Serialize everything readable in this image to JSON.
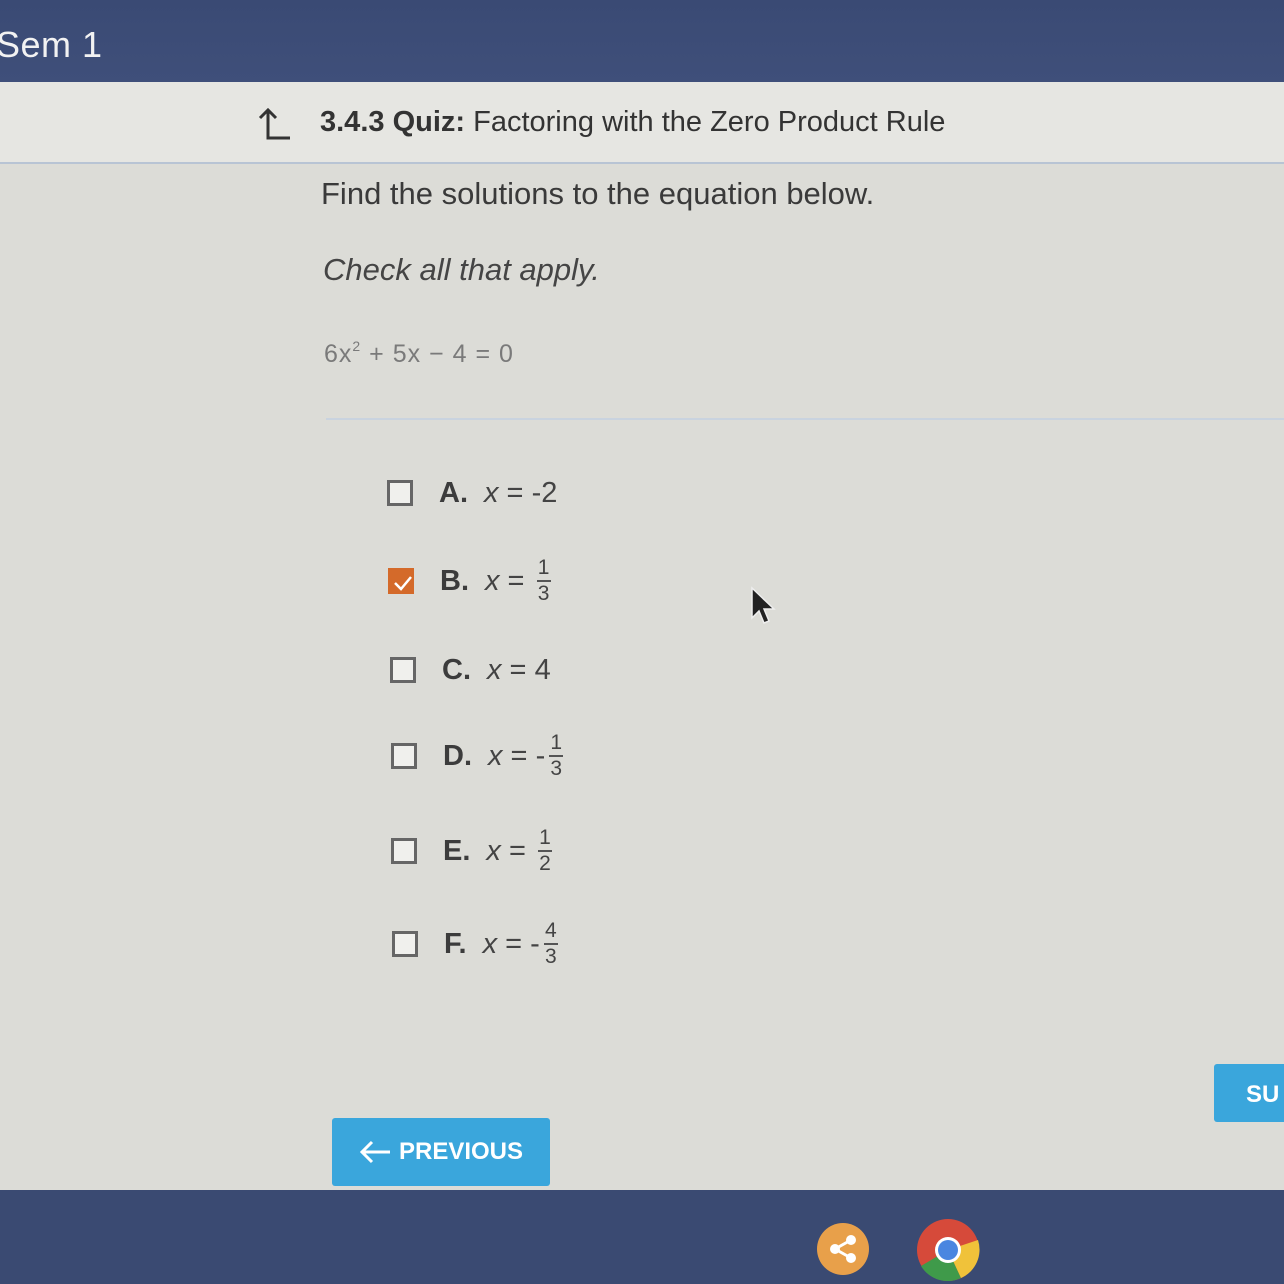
{
  "header": {
    "course": "Sem 1"
  },
  "quiz_title": {
    "number": "3.4.3",
    "label": "Quiz:",
    "name": "Factoring with the Zero Product Rule"
  },
  "question": {
    "prompt": "Find the solutions to the equation below.",
    "instruction": "Check all that apply.",
    "equation": {
      "coeff": "6x",
      "exp": "2",
      "rest": " + 5x − 4 = 0"
    }
  },
  "options": [
    {
      "letter": "A.",
      "var": "x",
      "eq": " = ",
      "value": "-2",
      "checked": false
    },
    {
      "letter": "B.",
      "var": "x",
      "eq": " = ",
      "sign": "",
      "num": "1",
      "den": "3",
      "checked": true
    },
    {
      "letter": "C.",
      "var": "x",
      "eq": " = ",
      "value": "4",
      "checked": false
    },
    {
      "letter": "D.",
      "var": "x",
      "eq": " = ",
      "sign": "-",
      "num": "1",
      "den": "3",
      "checked": false
    },
    {
      "letter": "E.",
      "var": "x",
      "eq": " = ",
      "sign": "",
      "num": "1",
      "den": "2",
      "checked": false
    },
    {
      "letter": "F.",
      "var": "x",
      "eq": " = ",
      "sign": "-",
      "num": "4",
      "den": "3",
      "checked": false
    }
  ],
  "buttons": {
    "previous": "PREVIOUS",
    "submit": "SU"
  },
  "colors": {
    "accent": "#3aa6dc",
    "checked": "#d46a2a",
    "topbar": "#3a4a74"
  },
  "icons": {
    "up": "up-arrow-icon",
    "prev": "left-arrow-icon",
    "taskbar": [
      "share-app-icon",
      "chrome-icon"
    ]
  }
}
